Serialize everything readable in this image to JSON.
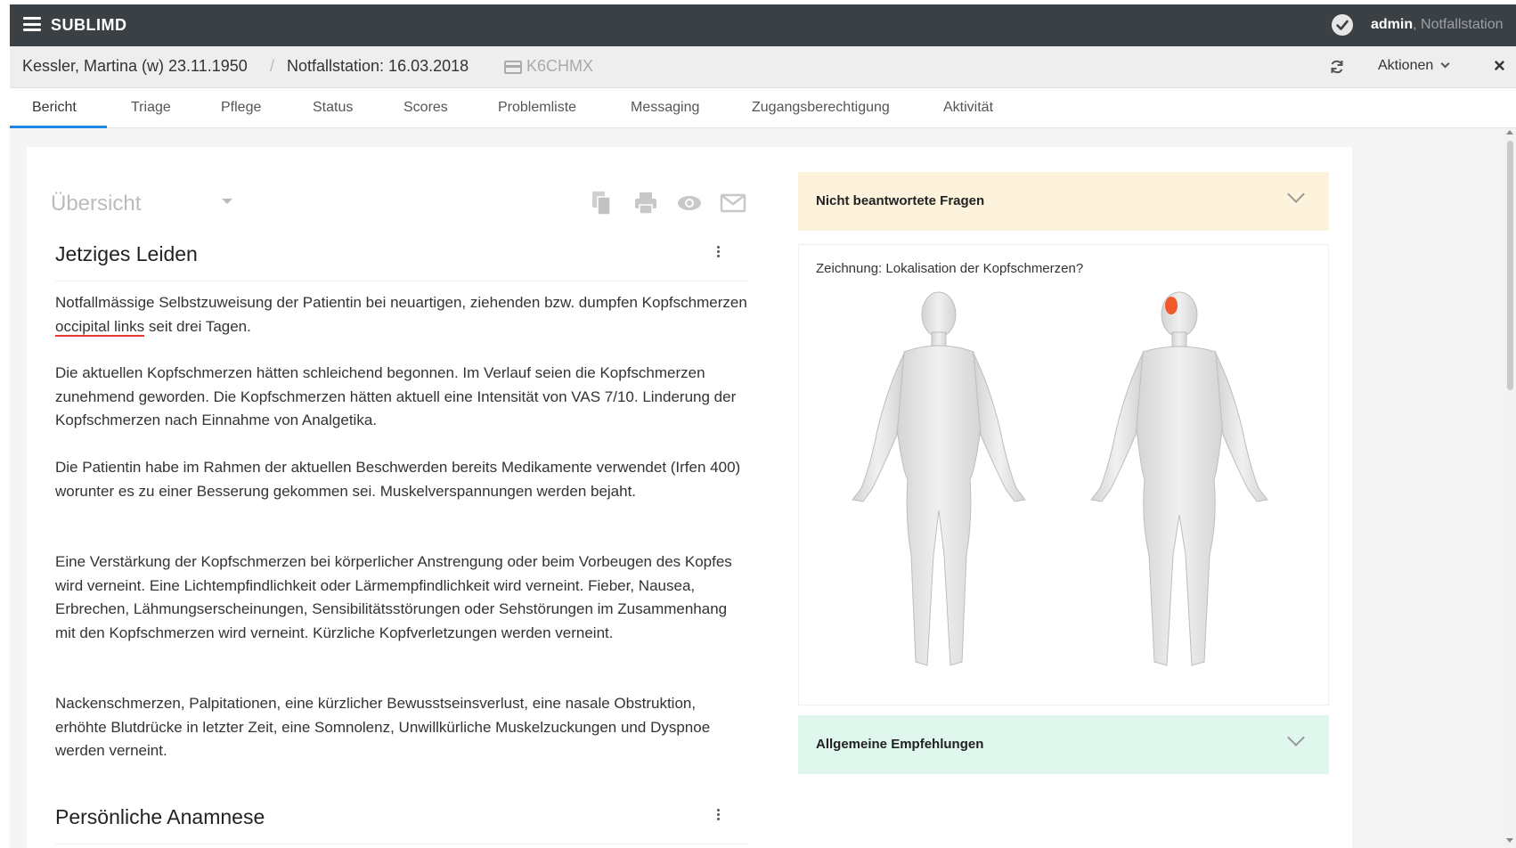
{
  "app": {
    "brand": "SUBLIMD"
  },
  "user": {
    "name": "admin",
    "separator": ", ",
    "station": "Notfallstation"
  },
  "patient": {
    "name": "Kessler, Martina (w) 23.11.1950",
    "separator": "/",
    "station_date": "Notfallstation: 16.03.2018",
    "code": "K6CHMX",
    "actions_label": "Aktionen"
  },
  "tabs": [
    {
      "label": "Bericht",
      "active": true
    },
    {
      "label": "Triage"
    },
    {
      "label": "Pflege"
    },
    {
      "label": "Status"
    },
    {
      "label": "Scores"
    },
    {
      "label": "Problemliste"
    },
    {
      "label": "Messaging"
    },
    {
      "label": "Zugangsberechtigung"
    },
    {
      "label": "Aktivität"
    }
  ],
  "report": {
    "view_selector": "Übersicht",
    "sections": [
      {
        "title": "Jetziges Leiden",
        "paragraphs": [
          {
            "before": "Notfallmässige Selbstzuweisung der Patientin bei neuartigen, ziehenden bzw. dumpfen Kopfschmerzen ",
            "highlight": "occipital links",
            "after": " seit drei Tagen."
          },
          {
            "text": "Die aktuellen Kopfschmerzen hätten schleichend begonnen. Im Verlauf seien die Kopfschmerzen zunehmend geworden. Die Kopfschmerzen hätten aktuell eine Intensität von VAS 7/10. Linderung der Kopfschmerzen nach Einnahme von Analgetika."
          },
          {
            "text": "Die Patientin habe im Rahmen der aktuellen Beschwerden bereits Medikamente verwendet (Irfen 400) worunter es zu einer Besserung gekommen sei. Muskelverspannungen werden bejaht."
          },
          {
            "text": "Eine Verstärkung der Kopfschmerzen bei körperlicher Anstrengung oder beim Vorbeugen des Kopfes wird verneint. Eine Lichtempfindlichkeit oder Lärmempfindlichkeit wird verneint. Fieber, Nausea, Erbrechen, Lähmungserscheinungen, Sensibilitätsstörungen oder Sehstörungen im Zusammenhang mit den Kopfschmerzen wird verneint. Kürzliche Kopfverletzungen werden verneint."
          },
          {
            "text": "Nackenschmerzen, Palpitationen, eine kürzlicher Bewusstseinsverlust, eine nasale Obstruktion, erhöhte Blutdrücke in letzter Zeit, eine Somnolenz, Unwillkürliche Muskelzuckungen und Dyspnoe werden verneint."
          }
        ]
      },
      {
        "title": "Persönliche Anamnese"
      }
    ]
  },
  "side": {
    "unanswered_title": "Nicht beantwortete Fragen",
    "drawing_question": "Zeichnung: Lokalisation der Kopfschmerzen?",
    "recommendations_title": "Allgemeine Empfehlungen"
  },
  "colors": {
    "topbar": "#3b4045",
    "accent": "#1e88e5",
    "warning_panel": "#fdf3dc",
    "success_panel": "#dff7ec",
    "pain_marker": "#f05a28"
  },
  "icons": [
    "menu-icon",
    "check-circle-icon",
    "id-card-icon",
    "refresh-icon",
    "chevron-down-icon",
    "close-icon",
    "copy-icon",
    "print-icon",
    "eye-icon",
    "mail-icon",
    "kebab-icon"
  ]
}
